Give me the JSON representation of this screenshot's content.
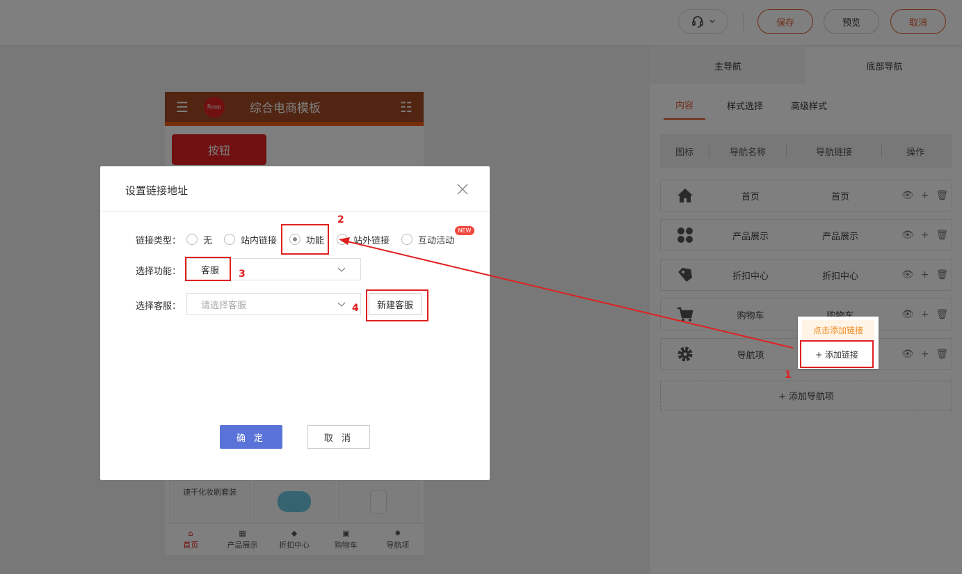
{
  "topbar": {
    "save": "保存",
    "preview": "预览",
    "cancel": "取消"
  },
  "right_panel": {
    "nav_tabs": [
      "主导航",
      "底部导航"
    ],
    "sub_tabs": [
      "内容",
      "样式选择",
      "高级样式"
    ],
    "active_sub_tab": "内容",
    "table_headers": [
      "图标",
      "导航名称",
      "导航链接",
      "操作"
    ],
    "rows": [
      {
        "icon": "home-icon",
        "name": "首页",
        "link": "首页"
      },
      {
        "icon": "grid-icon",
        "name": "产品展示",
        "link": "产品展示"
      },
      {
        "icon": "tag-icon",
        "name": "折扣中心",
        "link": "折扣中心"
      },
      {
        "icon": "cart-icon",
        "name": "购物车",
        "link": "购物车"
      },
      {
        "icon": "gear-icon",
        "name": "导航项",
        "link": ""
      }
    ],
    "add_nav": "+ 添加导航项",
    "tooltip": "点击添加链接",
    "add_link": "+ 添加链接"
  },
  "phone": {
    "title": "综合电商模板",
    "logo": "Roop",
    "button": "按钮",
    "card_text": "速干化妆刷套装",
    "bottom_nav": [
      "首页",
      "产品展示",
      "折扣中心",
      "购物车",
      "导航项"
    ]
  },
  "dialog": {
    "title": "设置链接地址",
    "link_type_label": "链接类型：",
    "link_types": [
      "无",
      "站内链接",
      "功能",
      "站外链接",
      "互动活动"
    ],
    "selected_type": "功能",
    "new_badge": "NEW",
    "func_label": "选择功能：",
    "func_value": "客服",
    "cs_label": "选择客服：",
    "cs_placeholder": "请选择客服",
    "new_cs_button": "新建客服",
    "ok": "确 定",
    "cancel": "取 消"
  },
  "annotations": [
    "1",
    "2",
    "3",
    "4"
  ],
  "colors": {
    "accent": "#e0582c",
    "annotation_red": "#e02020",
    "primary_blue": "#5a73d8"
  }
}
